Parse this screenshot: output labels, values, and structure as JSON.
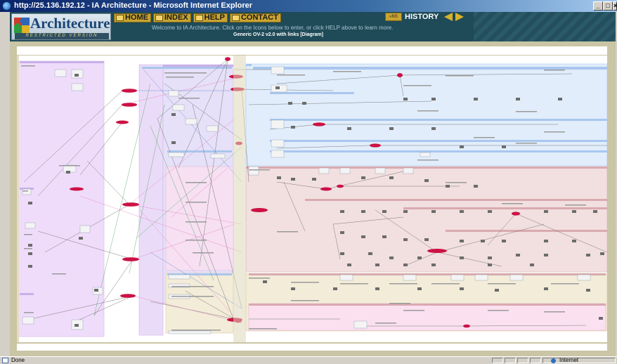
{
  "window": {
    "title": "http://25.136.192.12 - IA Architecture - Microsoft Internet Explorer",
    "buttons": {
      "minimize": "_",
      "maximize": "□",
      "close": "×"
    }
  },
  "header": {
    "logo_text": "Architecture",
    "logo_subtext": "RESTRICTED VERSION",
    "nav": [
      {
        "label": "HOME",
        "icon": "home-icon"
      },
      {
        "label": "INDEX",
        "icon": "index-icon"
      },
      {
        "label": "HELP",
        "icon": "help-icon"
      },
      {
        "label": "CONTACT",
        "icon": "contact-icon"
      }
    ],
    "welcome": "Welcome to IA Architecture. Click on the Icons below to enter, or click HELP above to learn more.",
    "page_subtitle": "Generic OV-2 v2.0 with links [Diagram]",
    "history_label": "HISTORY",
    "history_box": "«NS"
  },
  "status": {
    "text": "Done",
    "zone": "Internet"
  },
  "colors": {
    "title_bar": "#0a246a",
    "header_bg": "#1f4a58",
    "nav_gold": "#c9a431",
    "diagram_bg": "#ffffff",
    "node_red": "#cc1144",
    "lavender": "#efdcfb",
    "blue_panel": "#e1edfb",
    "pink_panel": "#f2dfdf",
    "beige_panel": "#f3ecd8"
  }
}
